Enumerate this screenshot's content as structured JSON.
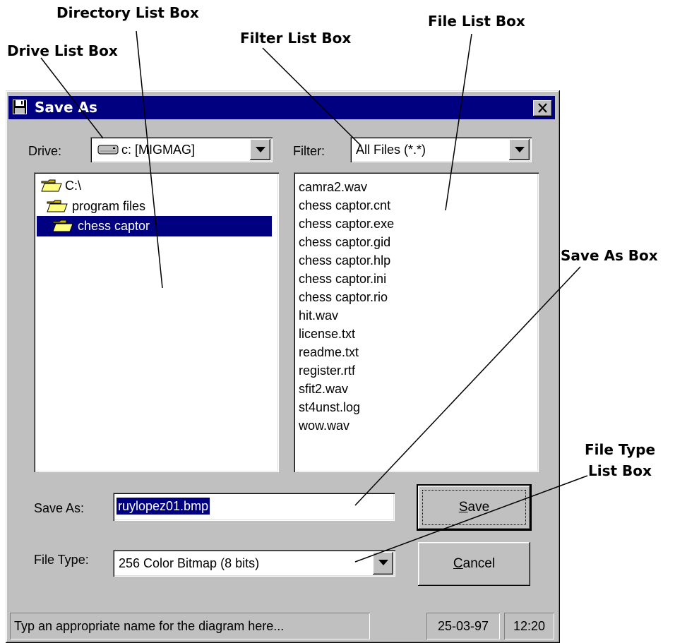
{
  "annotations": {
    "directory_list_box": "Directory List Box",
    "drive_list_box": "Drive List Box",
    "filter_list_box": "Filter List Box",
    "file_list_box": "File List Box",
    "save_as_box": "Save As Box",
    "file_type_list_box_line1": "File Type",
    "file_type_list_box_line2": "List Box"
  },
  "window": {
    "title": "Save As",
    "close_icon": "close-icon",
    "title_icon": "floppy-disk-icon"
  },
  "drive": {
    "label": "Drive:",
    "value": "c: [MIGMAG]",
    "icon": "hard-drive-icon"
  },
  "filter": {
    "label": "Filter:",
    "value": "All Files  (*.*)"
  },
  "directories": [
    {
      "name": "C:\\",
      "icon": "open-folder-icon",
      "selected": false
    },
    {
      "name": "program files",
      "icon": "open-folder-icon",
      "selected": false
    },
    {
      "name": "chess captor",
      "icon": "open-folder-icon",
      "selected": true
    }
  ],
  "files": [
    "camra2.wav",
    "chess captor.cnt",
    "chess captor.exe",
    "chess captor.gid",
    "chess captor.hlp",
    "chess captor.ini",
    "chess captor.rio",
    "hit.wav",
    "license.txt",
    "readme.txt",
    "register.rtf",
    "sfit2.wav",
    "st4unst.log",
    "wow.wav"
  ],
  "save_as": {
    "label": "Save As:",
    "value": "ruylopez01.bmp"
  },
  "file_type": {
    "label": "File Type:",
    "value": "256 Color Bitmap (8 bits)"
  },
  "buttons": {
    "save_rest": "ave",
    "save_mnemonic": "S",
    "cancel_rest": "ancel",
    "cancel_mnemonic": "C"
  },
  "status_bar": {
    "message": "Typ an appropriate name for the diagram here...",
    "date": "25-03-97",
    "time": "12:20"
  },
  "colors": {
    "title_bar": "#000080",
    "face": "#c0c0c0",
    "selection": "#000080"
  }
}
